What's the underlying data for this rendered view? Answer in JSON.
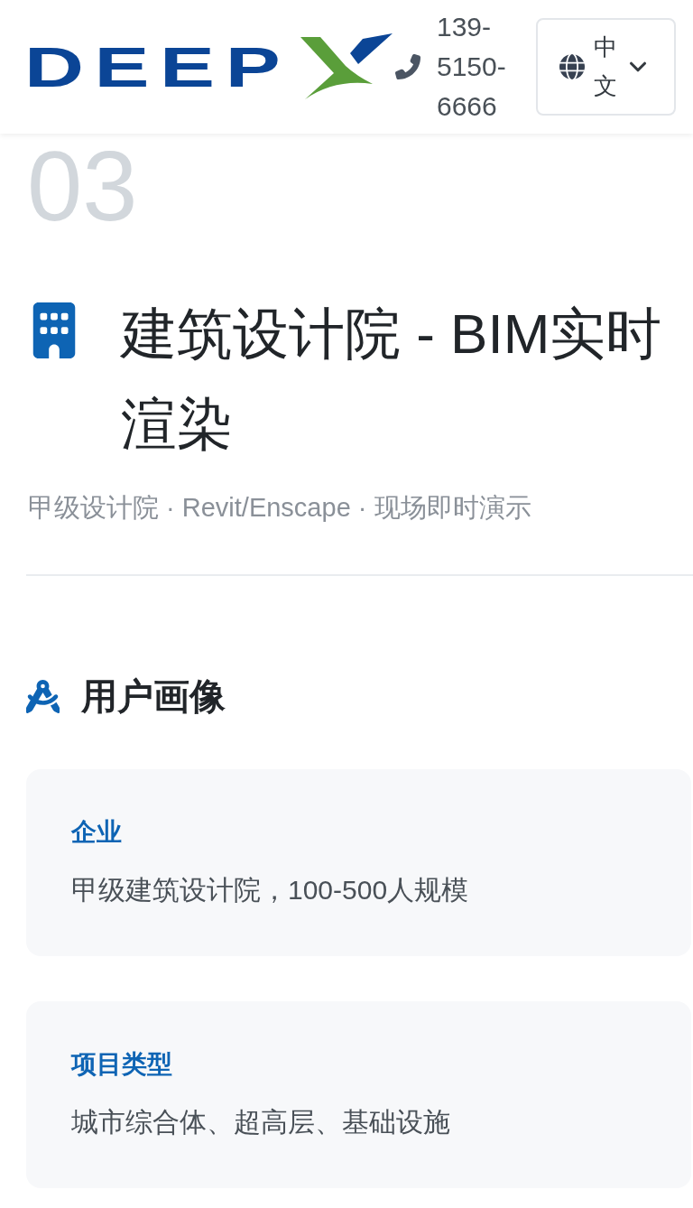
{
  "header": {
    "logo": {
      "text": "DEEP"
    },
    "phone": "139-5150-6666",
    "language": {
      "label": "中文"
    }
  },
  "case": {
    "number": "03",
    "title": "建筑设计院 - BIM实时渲染",
    "subtitle": "甲级设计院 · Revit/Enscape · 现场即时演示"
  },
  "user_profile": {
    "title": "用户画像",
    "cards": [
      {
        "label": "企业",
        "value": "甲级建筑设计院，100-500人规模"
      },
      {
        "label": "项目类型",
        "value": "城市综合体、超高层、基础设施"
      }
    ]
  }
}
